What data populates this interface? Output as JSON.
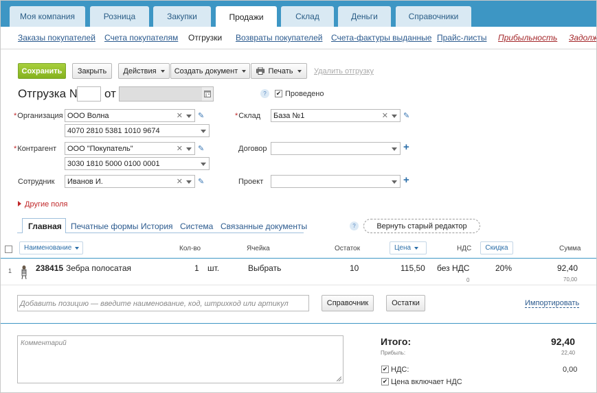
{
  "top_tabs": [
    {
      "label": "Моя компания"
    },
    {
      "label": "Розница"
    },
    {
      "label": "Закупки"
    },
    {
      "label": "Продажи",
      "active": true
    },
    {
      "label": "Склад"
    },
    {
      "label": "Деньги"
    },
    {
      "label": "Справочники"
    }
  ],
  "sub_nav": [
    {
      "label": "Заказы покупателей"
    },
    {
      "label": "Счета покупателям"
    },
    {
      "label": "Отгрузки",
      "current": true
    },
    {
      "label": "Возвраты покупателей"
    },
    {
      "label": "Счета-фактуры выданные"
    },
    {
      "label": "Прайс-листы"
    },
    {
      "label": "Прибыльность"
    },
    {
      "label": "Задолж"
    }
  ],
  "toolbar": {
    "save": "Сохранить",
    "close": "Закрыть",
    "actions": "Действия",
    "create_doc": "Создать документ",
    "print": "Печать",
    "delete": "Удалить отгрузку"
  },
  "doc": {
    "title": "Отгрузка №",
    "number": "",
    "from": "от",
    "posted_label": "Проведено",
    "posted": true
  },
  "form": {
    "org_label": "Организация",
    "org_value": "ООО Волна",
    "org_account": "4070 2810 5381 1010 9674",
    "contractor_label": "Контрагент",
    "contractor_value": "ООО \"Покупатель\"",
    "contractor_account": "3030 1810 5000 0100 0001",
    "employee_label": "Сотрудник",
    "employee_value": "Иванов И.",
    "warehouse_label": "Склад",
    "warehouse_value": "База №1",
    "contract_label": "Договор",
    "contract_value": "",
    "project_label": "Проект",
    "project_value": "",
    "other_fields": "Другие поля"
  },
  "doc_tabs": [
    {
      "label": "Главная",
      "active": true
    },
    {
      "label": "Печатные формы"
    },
    {
      "label": "История"
    },
    {
      "label": "Система"
    },
    {
      "label": "Связанные документы"
    }
  ],
  "old_editor": "Вернуть старый редактор",
  "table": {
    "headers": {
      "name": "Наименование",
      "qty": "Кол-во",
      "cell": "Ячейка",
      "stock": "Остаток",
      "price": "Цена",
      "vat": "НДС",
      "discount": "Скидка",
      "sum": "Сумма"
    },
    "rows": [
      {
        "index": "1",
        "code": "238415",
        "name": "Зебра полосатая",
        "qty": "1",
        "unit": "шт.",
        "cell": "Выбрать",
        "stock": "10",
        "price": "115,50",
        "vat": "без НДС",
        "vat_sub": "0",
        "discount": "20%",
        "sum": "92,40",
        "sum_sub": "70,00"
      }
    ]
  },
  "add_position": {
    "placeholder": "Добавить позицию — введите наименование, код, штрихкод или артикул",
    "catalog_btn": "Справочник",
    "stock_btn": "Остатки",
    "import_link": "Импортировать"
  },
  "footer": {
    "comment_placeholder": "Комментарий",
    "total_label": "Итого:",
    "total_value": "92,40",
    "profit_label": "Прибыль:",
    "profit_value": "22,40",
    "vat_label": "НДС:",
    "vat_value": "0,00",
    "vat_checked": true,
    "price_incl_vat_label": "Цена включает НДС",
    "price_incl_vat_checked": true
  },
  "colors": {
    "nav_bg": "#3d96c4",
    "accent_green": "#84b21e",
    "link": "#2b5a8e",
    "required": "#c0282a"
  }
}
